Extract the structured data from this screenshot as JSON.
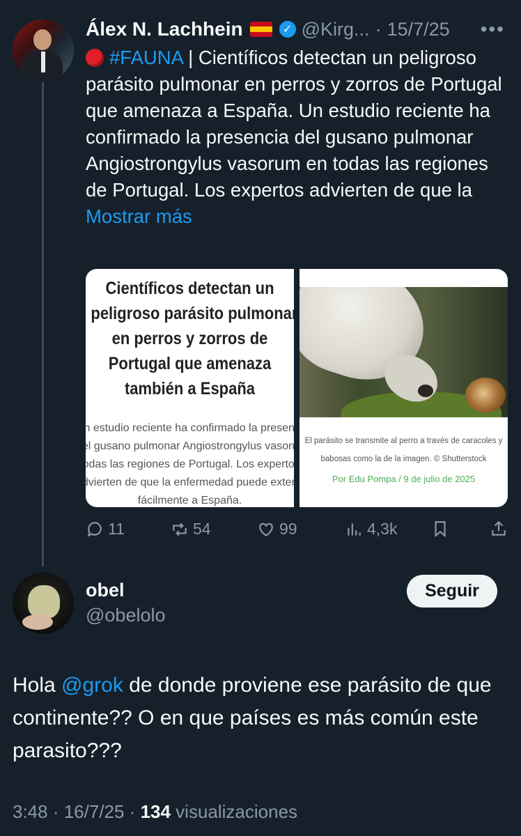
{
  "post": {
    "author_name": "Álex N. Lachhein",
    "handle": "@Kirg...",
    "date": "15/7/25",
    "hashtag": "#FAUNA",
    "text": " | Científicos detectan un peligroso parásito pulmonar en perros y zorros de Portugal que amenaza a España. Un estudio reciente ha confirmado la presencia del gusano pulmonar Angiostrongylus vasorum en todas las regiones de Portugal. Los expertos advierten de que la ",
    "show_more": "Mostrar más",
    "card": {
      "headline": [
        "Científicos detectan un",
        "peligroso parásito pulmonar",
        "en perros y zorros de",
        "Portugal que amenaza",
        "también a España"
      ],
      "body": [
        "Un estudio reciente ha confirmado la presencia",
        "del gusano pulmonar Angiostrongylus vasorum en",
        "todas las regiones de Portugal. Los expertos",
        "advierten de que la enfermedad puede extenderse",
        "fácilmente a España."
      ],
      "caption": [
        "El parásito se transmite al perro a través de caracoles y",
        "babosas como la de la imagen. © Shutterstock"
      ],
      "byline": "Por Edu Pompa / 9 de julio de 2025"
    },
    "stats": {
      "replies": "11",
      "reposts": "54",
      "likes": "99",
      "views": "4,3k"
    }
  },
  "reply": {
    "author_name": "obel",
    "handle": "@obelolo",
    "follow_label": "Seguir",
    "text_before": "Hola ",
    "mention": "@grok",
    "text_after": "  de donde proviene ese parásito de que continente?? O en que países es más común este parasito???",
    "time": "3:48 · 16/7/25 · ",
    "views_count": "134",
    "views_label": " visualizaciones"
  },
  "colors": {
    "background": "#15202b",
    "accent": "#1d9bf0",
    "muted": "#8b98a5"
  },
  "icons": [
    "verified-badge-icon",
    "more-icon",
    "reply-icon",
    "repost-icon",
    "like-icon",
    "views-icon",
    "bookmark-icon",
    "share-icon",
    "spain-flag-icon",
    "red-circle-emoji-icon"
  ]
}
